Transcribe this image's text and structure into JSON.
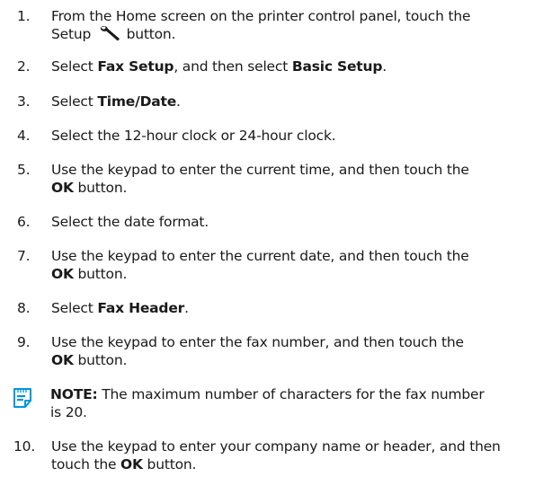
{
  "steps": [
    {
      "num": "1.",
      "line1_before": "From the Home screen on the printer control panel, touch the",
      "line2_before": "Setup",
      "line2_after": "button.",
      "icon": "wrench-icon"
    },
    {
      "num": "2.",
      "before": "Select ",
      "bold1": "Fax Setup",
      "middle": ", and then select ",
      "bold2": "Basic Setup",
      "after": "."
    },
    {
      "num": "3.",
      "before": "Select ",
      "bold": "Time/Date",
      "after": "."
    },
    {
      "num": "4.",
      "text": "Select the 12-hour clock or 24-hour clock."
    },
    {
      "num": "5.",
      "line1": "Use the keypad to enter the current time, and then touch the",
      "line2_bold": "OK",
      "line2_after": " button."
    },
    {
      "num": "6.",
      "text": "Select the date format."
    },
    {
      "num": "7.",
      "line1": "Use the keypad to enter the current date, and then touch the",
      "line2_bold": "OK",
      "line2_after": " button."
    },
    {
      "num": "8.",
      "before": "Select ",
      "bold": "Fax Header",
      "after": "."
    },
    {
      "num": "9.",
      "line1": "Use the keypad to enter the fax number, and then touch the",
      "line2_bold": "OK",
      "line2_after": " button."
    },
    {
      "num": "10.",
      "line1": "Use the keypad to enter your company name or header, and then",
      "line2_before": "touch the ",
      "line2_bold": "OK",
      "line2_after": " button."
    }
  ],
  "note": {
    "label": "NOTE:",
    "line1": " The maximum number of characters for the fax number",
    "line2": "is 20.",
    "icon": "note-icon",
    "icon_color": "#0096d6"
  }
}
